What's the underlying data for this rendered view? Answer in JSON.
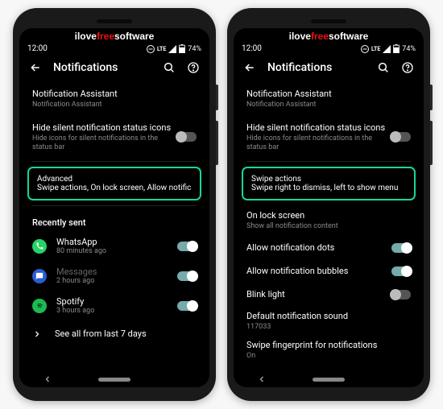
{
  "watermark": {
    "p1": "ilove",
    "p2": "free",
    "p3": "software"
  },
  "statusbar": {
    "time": "12:00",
    "lte": "LTE",
    "battery": "74%"
  },
  "header": {
    "title": "Notifications"
  },
  "common": {
    "na": {
      "title": "Notification Assistant",
      "sub": "Notification Assistant"
    },
    "hide": {
      "title": "Hide silent notification status icons",
      "sub": "Hide icons for silent notifications in the status bar"
    }
  },
  "left": {
    "advanced": {
      "title": "Advanced",
      "sub": "Swipe actions, On lock screen, Allow notification d.."
    },
    "recent_head": "Recently sent",
    "apps": [
      {
        "name": "WhatsApp",
        "time": "80 minutes ago",
        "iconbg": "#25d366",
        "glyph": "phone",
        "on": true
      },
      {
        "name": "Messages",
        "time": "2 hours ago",
        "iconbg": "#2b5bd6",
        "glyph": "chat",
        "on": true,
        "dim": true
      },
      {
        "name": "Spotify",
        "time": "3 hours ago",
        "iconbg": "#1db954",
        "glyph": "spot",
        "on": true
      }
    ],
    "seeall": "See all from last 7 days"
  },
  "right": {
    "swipe": {
      "title": "Swipe actions",
      "sub": "Swipe right to dismiss, left to show menu"
    },
    "lock": {
      "title": "On lock screen",
      "sub": "Show all notification content"
    },
    "dots": {
      "title": "Allow notification dots"
    },
    "bubbles": {
      "title": "Allow notification bubbles"
    },
    "blink": {
      "title": "Blink light"
    },
    "sound": {
      "title": "Default notification sound",
      "sub": "117033"
    },
    "fp": {
      "title": "Swipe fingerprint for notifications",
      "sub": "On"
    }
  }
}
